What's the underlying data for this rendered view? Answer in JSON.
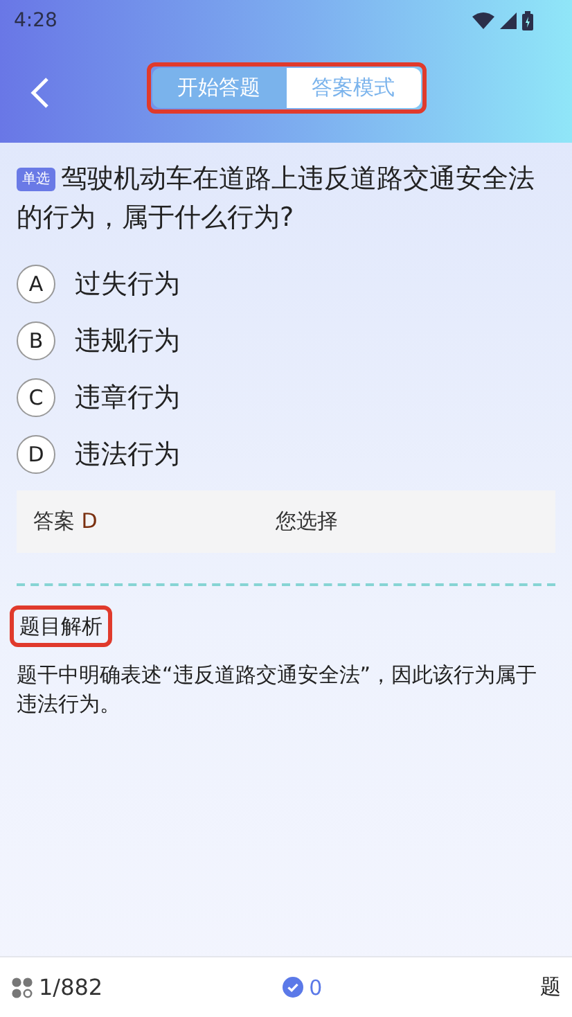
{
  "status_bar": {
    "time": "4:28"
  },
  "header": {
    "tabs": [
      {
        "label": "开始答题",
        "selected": true
      },
      {
        "label": "答案模式",
        "selected": false
      }
    ]
  },
  "question": {
    "type_tag": "单选",
    "text": "驾驶机动车在道路上违反道路交通安全法的行为，属于什么行为?"
  },
  "options": [
    {
      "letter": "A",
      "text": "过失行为",
      "selected": false
    },
    {
      "letter": "B",
      "text": "违规行为",
      "selected": false
    },
    {
      "letter": "C",
      "text": "违章行为",
      "selected": false
    },
    {
      "letter": "D",
      "text": "违法行为",
      "selected": false
    }
  ],
  "answer": {
    "label": "答案",
    "value": "D",
    "your_choice_label": "您选择"
  },
  "analysis": {
    "title": "题目解析",
    "text": "题干中明确表述“违反道路交通安全法”，因此该行为属于违法行为。"
  },
  "bottom_bar": {
    "progress": "1/882",
    "correct_count": "0",
    "right_text": "题"
  }
}
